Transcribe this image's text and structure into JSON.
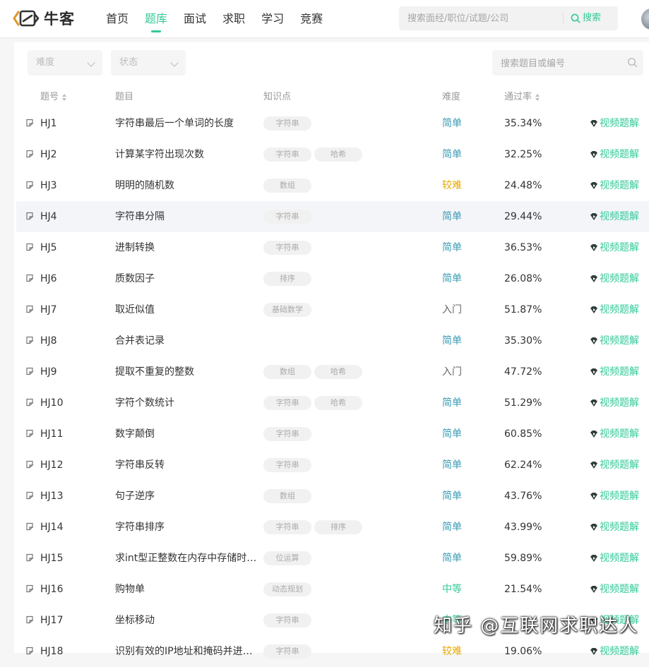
{
  "brand": {
    "name": "牛客"
  },
  "nav": {
    "items": [
      "首页",
      "题库",
      "面试",
      "求职",
      "学习",
      "竞赛"
    ],
    "active_index": 1
  },
  "search": {
    "placeholder": "搜索面经/职位/试题/公司",
    "button_label": "搜索"
  },
  "filters": {
    "difficulty_placeholder": "难度",
    "status_placeholder": "状态",
    "question_search_placeholder": "搜索题目或编号"
  },
  "table": {
    "headers": {
      "id": "题号",
      "title": "题目",
      "knowledge": "知识点",
      "difficulty": "难度",
      "pass_rate": "通过率"
    },
    "video_label": "视频题解",
    "rows": [
      {
        "id": "HJ1",
        "title": "字符串最后一个单词的长度",
        "tags": [
          "字符串"
        ],
        "difficulty": "简单",
        "pass_rate": "35.34%"
      },
      {
        "id": "HJ2",
        "title": "计算某字符出现次数",
        "tags": [
          "字符串",
          "哈希"
        ],
        "difficulty": "简单",
        "pass_rate": "32.25%"
      },
      {
        "id": "HJ3",
        "title": "明明的随机数",
        "tags": [
          "数组"
        ],
        "difficulty": "较难",
        "pass_rate": "24.48%"
      },
      {
        "id": "HJ4",
        "title": "字符串分隔",
        "tags": [
          "字符串"
        ],
        "difficulty": "简单",
        "pass_rate": "29.44%"
      },
      {
        "id": "HJ5",
        "title": "进制转换",
        "tags": [
          "字符串"
        ],
        "difficulty": "简单",
        "pass_rate": "36.53%"
      },
      {
        "id": "HJ6",
        "title": "质数因子",
        "tags": [
          "排序"
        ],
        "difficulty": "简单",
        "pass_rate": "26.08%"
      },
      {
        "id": "HJ7",
        "title": "取近似值",
        "tags": [
          "基础数学"
        ],
        "difficulty": "入门",
        "pass_rate": "51.87%"
      },
      {
        "id": "HJ8",
        "title": "合并表记录",
        "tags": [],
        "difficulty": "简单",
        "pass_rate": "35.30%"
      },
      {
        "id": "HJ9",
        "title": "提取不重复的整数",
        "tags": [
          "数组",
          "哈希"
        ],
        "difficulty": "入门",
        "pass_rate": "47.72%"
      },
      {
        "id": "HJ10",
        "title": "字符个数统计",
        "tags": [
          "字符串",
          "哈希"
        ],
        "difficulty": "简单",
        "pass_rate": "51.29%"
      },
      {
        "id": "HJ11",
        "title": "数字颠倒",
        "tags": [
          "字符串"
        ],
        "difficulty": "简单",
        "pass_rate": "60.85%"
      },
      {
        "id": "HJ12",
        "title": "字符串反转",
        "tags": [
          "字符串"
        ],
        "difficulty": "简单",
        "pass_rate": "62.24%"
      },
      {
        "id": "HJ13",
        "title": "句子逆序",
        "tags": [
          "数组"
        ],
        "difficulty": "简单",
        "pass_rate": "43.76%"
      },
      {
        "id": "HJ14",
        "title": "字符串排序",
        "tags": [
          "字符串",
          "排序"
        ],
        "difficulty": "简单",
        "pass_rate": "43.99%"
      },
      {
        "id": "HJ15",
        "title": "求int型正整数在内存中存储时…",
        "tags": [
          "位运算"
        ],
        "difficulty": "简单",
        "pass_rate": "59.89%"
      },
      {
        "id": "HJ16",
        "title": "购物单",
        "tags": [
          "动态规划"
        ],
        "difficulty": "中等",
        "pass_rate": "21.54%"
      },
      {
        "id": "HJ17",
        "title": "坐标移动",
        "tags": [
          "字符串"
        ],
        "difficulty": "中等",
        "pass_rate": ""
      },
      {
        "id": "HJ18",
        "title": "识别有效的IP地址和掩码并进…",
        "tags": [
          "字符串"
        ],
        "difficulty": "较难",
        "pass_rate": "19.06%"
      }
    ]
  },
  "watermark": {
    "text": "知乎 @互联网求职达人"
  },
  "colors": {
    "accent": "#32ca99",
    "easy": "#3a9bb5",
    "medium": "#32ca99",
    "hard": "#e8a800",
    "intro": "#666666"
  }
}
